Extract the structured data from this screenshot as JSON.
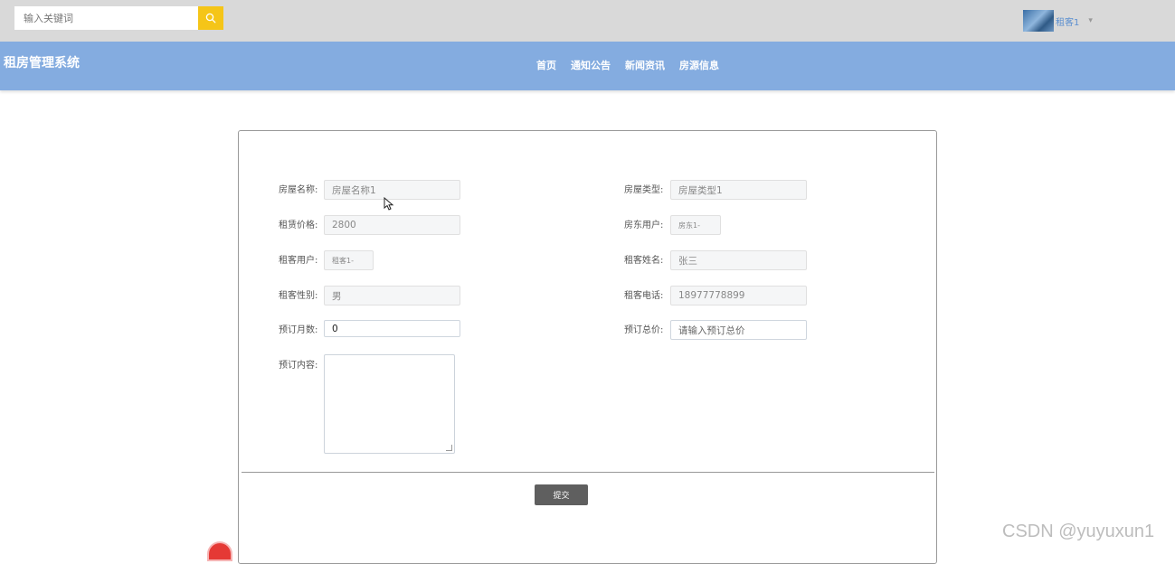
{
  "search": {
    "placeholder": "输入关键词"
  },
  "user": {
    "name": "租客1"
  },
  "brand": "租房管理系统",
  "nav": [
    "首页",
    "通知公告",
    "新闻资讯",
    "房源信息"
  ],
  "form": {
    "house_name": {
      "label": "房屋名称:",
      "value": "房屋名称1"
    },
    "house_type": {
      "label": "房屋类型:",
      "value": "房屋类型1"
    },
    "rent_price": {
      "label": "租赁价格:",
      "value": "2800"
    },
    "landlord": {
      "label": "房东用户:",
      "value": "房东1-"
    },
    "tenant_user": {
      "label": "租客用户:",
      "value": "租客1-"
    },
    "tenant_name": {
      "label": "租客姓名:",
      "value": "张三"
    },
    "tenant_gender": {
      "label": "租客性别:",
      "value": "男"
    },
    "tenant_phone": {
      "label": "租客电话:",
      "value": "18977778899"
    },
    "months": {
      "label": "预订月数:",
      "value": "0"
    },
    "total_price": {
      "label": "预订总价:",
      "placeholder": "请输入预订总价"
    },
    "content": {
      "label": "预订内容:"
    },
    "submit_label": "提交"
  },
  "watermark": "CSDN @yuyuxun1",
  "icons": {
    "search": "search-icon",
    "caret": "chevron-down-icon",
    "cursor": "mouse-cursor-icon"
  }
}
